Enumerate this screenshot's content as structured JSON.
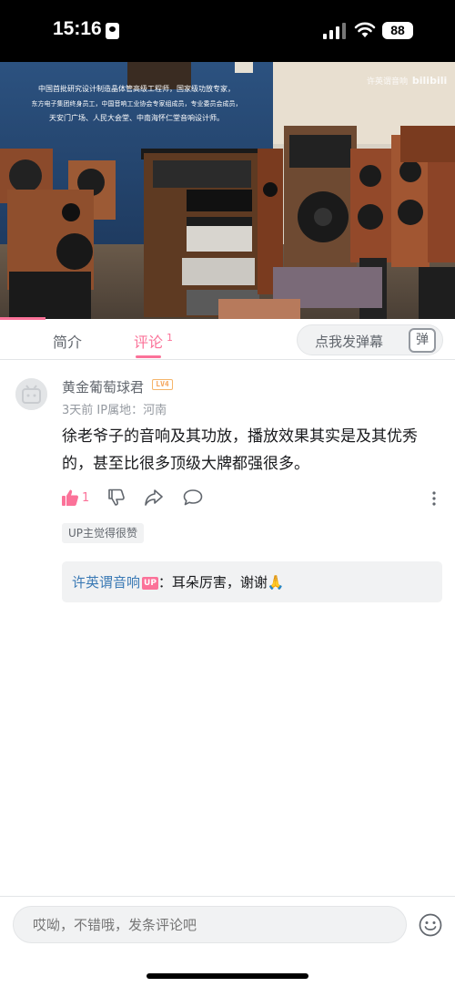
{
  "status_bar": {
    "time": "15:16",
    "battery": "88"
  },
  "video": {
    "overlay_lines": [
      "中国首批研究设计制造晶体管高级工程师，国家级功放专家，",
      "东方电子集团终身员工，中国音响工业协会专家组成员，专业委员会成员，",
      "天安门广场、人民大会堂、中南海怀仁堂音响设计师。"
    ],
    "watermark_channel": "许英谓音响",
    "watermark_brand": "bilibili",
    "progress_fraction": 0.1
  },
  "tabs": {
    "intro": "简介",
    "comments": "评论",
    "comments_count": "1",
    "danmaku_placeholder": "点我发弹幕",
    "danmaku_icon_label": "弹"
  },
  "comment": {
    "username": "黄金葡萄球君",
    "level": "LV4",
    "meta": "3天前  IP属地：河南",
    "text": "徐老爷子的音响及其功放，播放效果其实是及其优秀的，甚至比很多顶级大牌都强很多。",
    "like_count": "1",
    "up_liked": "UP主觉得很赞",
    "reply": {
      "author": "许英谓音响",
      "badge": "UP",
      "text": "：耳朵厉害，谢谢🙏"
    }
  },
  "bottom": {
    "input_placeholder": "哎呦，不错哦，发条评论吧"
  },
  "colors": {
    "accent": "#fb7299",
    "link": "#3b7ab5",
    "muted": "#9499a0"
  }
}
